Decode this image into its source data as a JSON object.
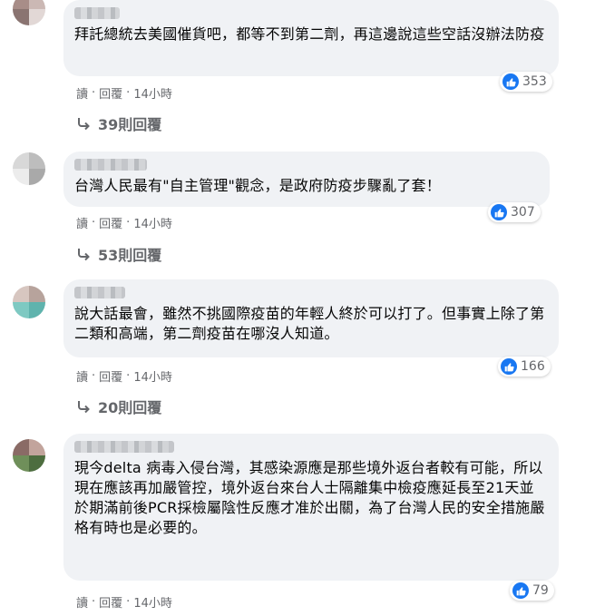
{
  "comments": [
    {
      "text": "拜託總統去美國催貨吧，都等不到第二劑，再這邊說這些空話沒辦法防疫",
      "likes": "353",
      "reply_label": "讀",
      "reply_action": "回覆",
      "time": "14小時",
      "replies_label": "39則回覆",
      "avatar_colors": [
        "#a88d88",
        "#cbb8b4",
        "#8a7471",
        "#e2d8d6"
      ]
    },
    {
      "text": "台灣人民最有\"自主管理\"觀念，是政府防疫步驟亂了套！",
      "likes": "307",
      "reply_label": "讀",
      "reply_action": "回覆",
      "time": "14小時",
      "replies_label": "53則回覆",
      "avatar_colors": [
        "#d8d8d8",
        "#bdbdbd",
        "#ececec",
        "#a9a9a9"
      ]
    },
    {
      "text": "說大話最會，雖然不挑國際疫苗的年輕人終於可以打了。但事實上除了第二類和高端，第二劑疫苗在哪沒人知道。",
      "likes": "166",
      "reply_label": "讀",
      "reply_action": "回覆",
      "time": "14小時",
      "replies_label": "20則回覆",
      "avatar_colors": [
        "#7ec9c2",
        "#d7c6c0",
        "#5fb3ad",
        "#b7a39c"
      ]
    },
    {
      "text": "現今delta 病毒入侵台灣，其感染源應是那些境外返台者較有可能，所以現在應該再加嚴管控，境外返台來台人士隔離集中檢疫應延長至21天並於期滿前後PCR採檢屬陰性反應才准於出關，為了台灣人民的安全措施嚴格有時也是必要的。",
      "likes": "79",
      "reply_label": "讀",
      "reply_action": "回覆",
      "time": "14小時",
      "replies_label": "",
      "avatar_colors": [
        "#8a6b66",
        "#6f8f5a",
        "#c2a49c",
        "#4d6d3f"
      ]
    }
  ],
  "colors": {
    "bubble_bg": "#f0f2f5",
    "like_blue": "#1877f2",
    "meta_gray": "#65676b"
  },
  "icons": {
    "like": "thumbs-up-icon",
    "replies": "reply-arrow-icon"
  }
}
